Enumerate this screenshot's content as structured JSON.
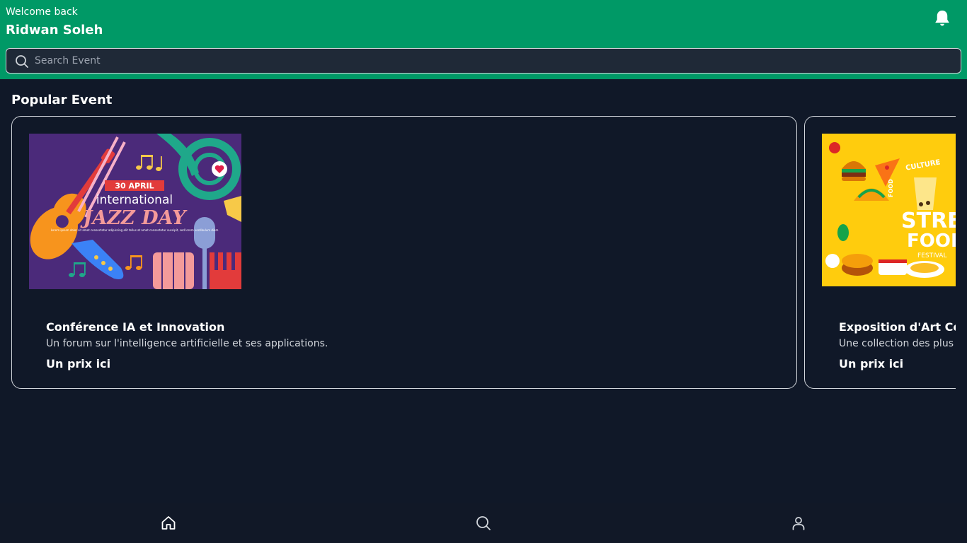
{
  "header": {
    "welcome": "Welcome back",
    "username": "Ridwan Soleh",
    "bell_icon": "bell-icon"
  },
  "search": {
    "placeholder": "Search Event",
    "value": "",
    "icon": "search-icon"
  },
  "popular": {
    "title": "Popular Event",
    "events": [
      {
        "title": "Conférence IA et Innovation",
        "description": "Un forum sur l'intelligence artificielle et ses applications.",
        "price": "Un prix ici",
        "image": {
          "banner": "30 APRIL",
          "line1": "international",
          "line2": "JAZZ DAY",
          "small_text": "Lorem ipsum dolor sit amet consectetur adipiscing elit tellus at amet consectetur suscipit, sed lorem vestibulum diam"
        }
      },
      {
        "title": "Exposition d'Art Cont",
        "description": "Une collection des plus be",
        "price": "Un prix ici",
        "image": {
          "line1": "STREE",
          "line2": "FOOD",
          "line3": "FESTIVAL",
          "arc_word": "CULTURE",
          "side_word": "FOOD"
        }
      }
    ]
  },
  "bottom_nav": {
    "items": [
      {
        "icon": "home-icon"
      },
      {
        "icon": "search-icon"
      },
      {
        "icon": "user-icon"
      }
    ]
  },
  "colors": {
    "header_bg": "#009966",
    "page_bg": "#101828",
    "search_bg": "#1f2937",
    "card_border": "#d1d5db",
    "jazz_bg": "#4b2a7a",
    "food_bg": "#ffcc0d"
  }
}
